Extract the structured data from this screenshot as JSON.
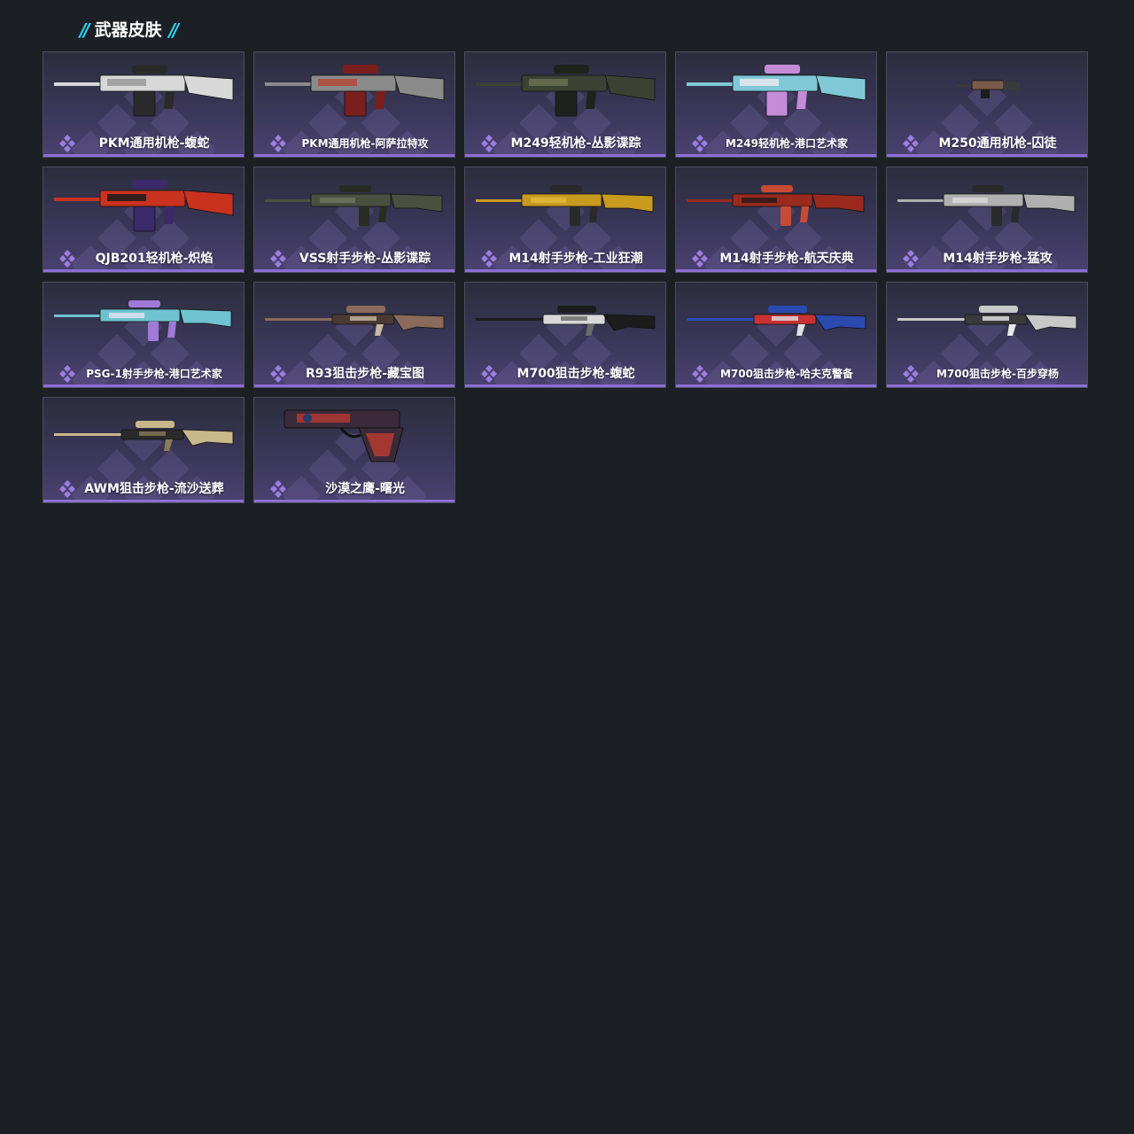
{
  "section": {
    "title": "武器皮肤",
    "accent_color": "#2fd3f0"
  },
  "theme": {
    "background": "#1c2025",
    "card_bar_color": "#8c6fd6",
    "rarity_icon_color": "#9b7ee0"
  },
  "skins": [
    {
      "name": "PKM通用机枪-蝮蛇",
      "icon": "machine-gun-white-camo-icon",
      "palette": [
        "#d8d8d8",
        "#2a2a2a",
        "#9a9a9a"
      ]
    },
    {
      "name": "PKM通用机枪-阿萨拉特攻",
      "icon": "machine-gun-red-camo-icon",
      "palette": [
        "#8a8a8a",
        "#7a1e1e",
        "#b04a3a"
      ]
    },
    {
      "name": "M249轻机枪-丛影谍踪",
      "icon": "light-machine-gun-green-camo-icon",
      "palette": [
        "#3c4233",
        "#1f221c",
        "#6b6f52"
      ]
    },
    {
      "name": "M249轻机枪-港口艺术家",
      "icon": "light-machine-gun-graffiti-icon",
      "palette": [
        "#7fc9d6",
        "#c48bd6",
        "#e8e8f0"
      ]
    },
    {
      "name": "M250通用机枪-囚徒",
      "icon": "machine-gun-small-icon",
      "palette": [
        "#3a3a3a",
        "#7a5a4a",
        "#1c1c1c"
      ]
    },
    {
      "name": "QJB201轻机枪-炽焰",
      "icon": "light-machine-gun-flame-icon",
      "palette": [
        "#c8321e",
        "#3a2a6a",
        "#1a1a1a"
      ]
    },
    {
      "name": "VSS射手步枪-丛影谍踪",
      "icon": "marksman-rifle-green-camo-icon",
      "palette": [
        "#4a5040",
        "#2a2c24",
        "#6e7260"
      ]
    },
    {
      "name": "M14射手步枪-工业狂潮",
      "icon": "marksman-rifle-yellow-icon",
      "palette": [
        "#c89a1e",
        "#2a2a2a",
        "#e0b83a"
      ]
    },
    {
      "name": "M14射手步枪-航天庆典",
      "icon": "marksman-rifle-red-icon",
      "palette": [
        "#9a2a1e",
        "#c84a32",
        "#2a1a1a"
      ]
    },
    {
      "name": "M14射手步枪-猛攻",
      "icon": "marksman-rifle-grey-icon",
      "palette": [
        "#b0b0b0",
        "#2a2a2a",
        "#d8d8d8"
      ]
    },
    {
      "name": "PSG-1射手步枪-港口艺术家",
      "icon": "marksman-rifle-graffiti-icon",
      "palette": [
        "#6fc3d0",
        "#a07ad8",
        "#e0e0f0"
      ]
    },
    {
      "name": "R93狙击步枪-藏宝图",
      "icon": "sniper-rifle-map-icon",
      "palette": [
        "#8a6a5a",
        "#4a3a32",
        "#c8b8a0"
      ]
    },
    {
      "name": "M700狙击步枪-蝮蛇",
      "icon": "sniper-rifle-white-camo-icon",
      "palette": [
        "#1c1c1c",
        "#d8d8d8",
        "#6a6a6a"
      ]
    },
    {
      "name": "M700狙击步枪-哈夫克警备",
      "icon": "sniper-rifle-blue-red-icon",
      "palette": [
        "#2a4ab0",
        "#c83232",
        "#e0e0e0"
      ]
    },
    {
      "name": "M700狙击步枪-百步穿杨",
      "icon": "sniper-rifle-silver-icon",
      "palette": [
        "#c8c8c8",
        "#3a3a3a",
        "#e8e8e8"
      ]
    },
    {
      "name": "AWM狙击步枪-流沙送葬",
      "icon": "sniper-rifle-sand-icon",
      "palette": [
        "#c8b88a",
        "#2a2a2a",
        "#8a7a5a"
      ]
    },
    {
      "name": "沙漠之鹰-曙光",
      "icon": "pistol-red-camo-icon",
      "palette": [
        "#3a2a3a",
        "#b83a32",
        "#2a3a6a"
      ]
    }
  ]
}
